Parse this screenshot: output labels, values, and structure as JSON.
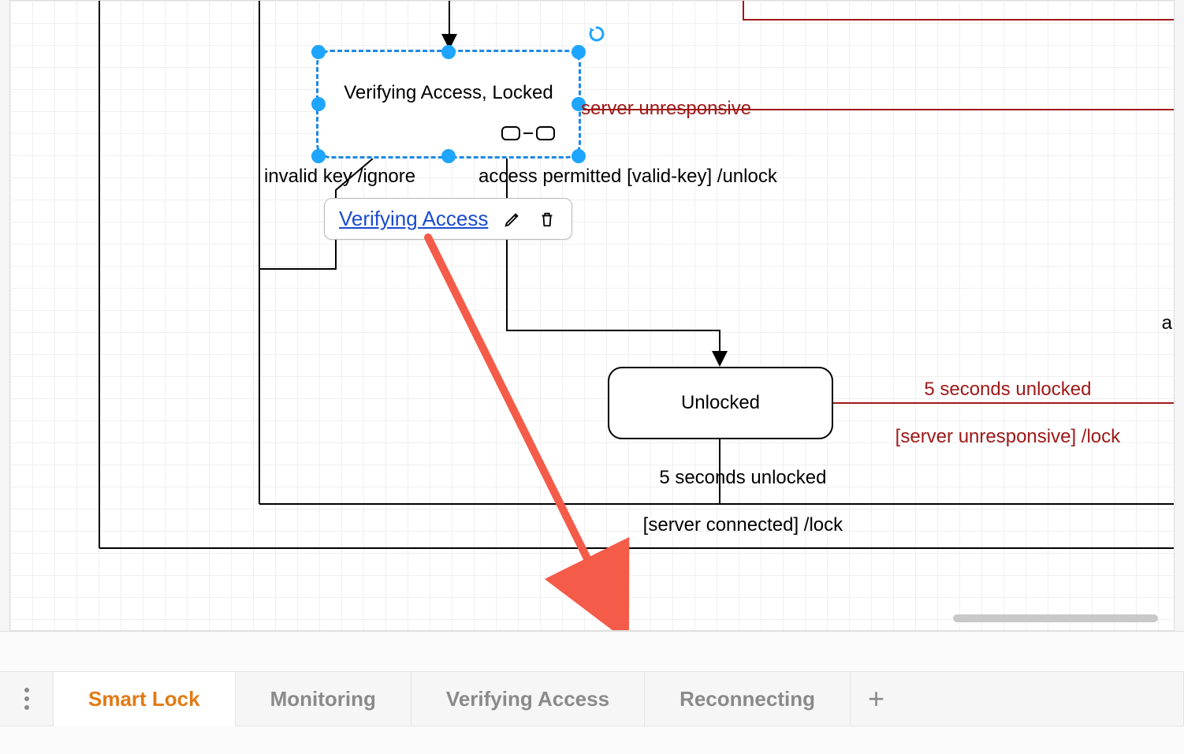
{
  "tabs": {
    "options_tooltip": "Options",
    "items": [
      {
        "label": "Smart Lock",
        "active": true
      },
      {
        "label": "Monitoring",
        "active": false
      },
      {
        "label": "Verifying Access",
        "active": false
      },
      {
        "label": "Reconnecting",
        "active": false
      }
    ],
    "add_tooltip": "Add Tab"
  },
  "diagram": {
    "selected_state": {
      "label": "Verifying Access, Locked"
    },
    "unlocked_state": {
      "label": "Unlocked"
    },
    "truncated_a": "a",
    "transitions": {
      "invalid_key": "invalid key /ignore",
      "access_permitted": "access permitted [valid-key] /unlock",
      "server_unresponsive": "server unresponsive",
      "five_sec_connected_line1": "5 seconds unlocked",
      "five_sec_connected_line2": "[server connected] /lock",
      "five_sec_unresp_line1": "5 seconds unlocked",
      "five_sec_unresp_line2": "[server unresponsive] /lock"
    },
    "popup": {
      "link_label": "Verifying Access",
      "edit_tooltip": "Edit",
      "delete_tooltip": "Delete"
    }
  }
}
